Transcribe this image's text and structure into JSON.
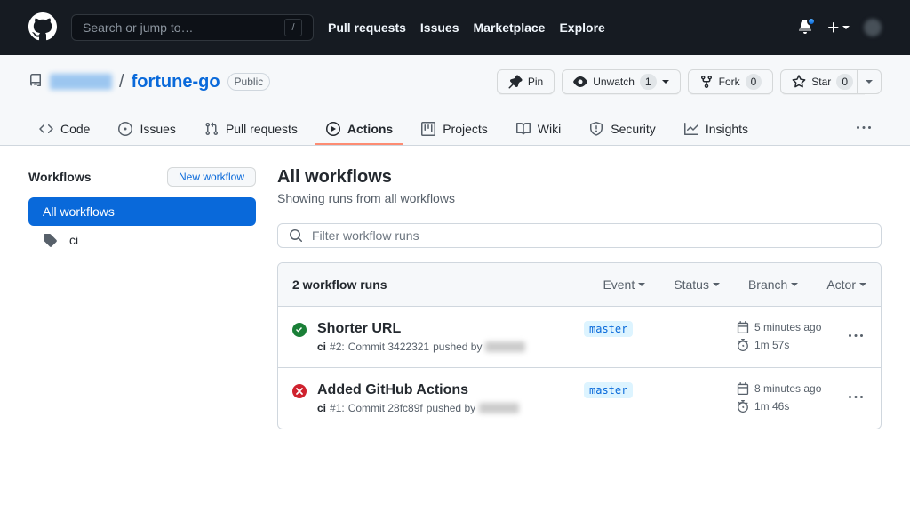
{
  "header": {
    "search_placeholder": "Search or jump to…",
    "slash": "/",
    "nav": {
      "pulls": "Pull requests",
      "issues": "Issues",
      "marketplace": "Marketplace",
      "explore": "Explore"
    }
  },
  "repo": {
    "name": "fortune-go",
    "visibility": "Public",
    "actions": {
      "pin": "Pin",
      "unwatch": "Unwatch",
      "unwatch_count": "1",
      "fork": "Fork",
      "fork_count": "0",
      "star": "Star",
      "star_count": "0"
    },
    "tabs": {
      "code": "Code",
      "issues": "Issues",
      "pulls": "Pull requests",
      "actions": "Actions",
      "projects": "Projects",
      "wiki": "Wiki",
      "security": "Security",
      "insights": "Insights"
    }
  },
  "sidebar": {
    "title": "Workflows",
    "new_workflow": "New workflow",
    "all": "All workflows",
    "items": [
      {
        "label": "ci"
      }
    ]
  },
  "page": {
    "title": "All workflows",
    "subtitle": "Showing runs from all workflows",
    "filter_placeholder": "Filter workflow runs",
    "count": "2 workflow runs",
    "filters": {
      "event": "Event",
      "status": "Status",
      "branch": "Branch",
      "actor": "Actor"
    }
  },
  "runs": [
    {
      "status": "success",
      "title": "Shorter URL",
      "workflow": "ci",
      "run_num": "#2:",
      "commit_msg": "Commit 3422321",
      "pushed_by": "pushed by",
      "branch": "master",
      "time_ago": "5 minutes ago",
      "duration": "1m 57s"
    },
    {
      "status": "failure",
      "title": "Added GitHub Actions",
      "workflow": "ci",
      "run_num": "#1:",
      "commit_msg": "Commit 28fc89f",
      "pushed_by": "pushed by",
      "branch": "master",
      "time_ago": "8 minutes ago",
      "duration": "1m 46s"
    }
  ]
}
